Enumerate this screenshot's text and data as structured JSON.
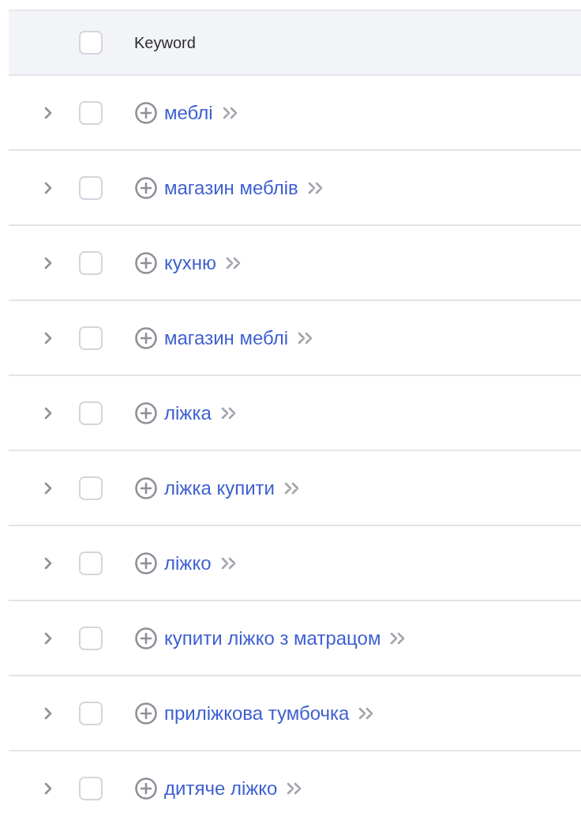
{
  "table": {
    "header": {
      "checked": false,
      "column": "Keyword"
    },
    "rows": [
      {
        "keyword": "меблі",
        "checked": false,
        "expanded": false
      },
      {
        "keyword": "магазин меблів",
        "checked": false,
        "expanded": false
      },
      {
        "keyword": "кухню",
        "checked": false,
        "expanded": false
      },
      {
        "keyword": "магазин меблі",
        "checked": false,
        "expanded": false
      },
      {
        "keyword": "ліжка",
        "checked": false,
        "expanded": false
      },
      {
        "keyword": "ліжка купити",
        "checked": false,
        "expanded": false
      },
      {
        "keyword": "ліжко",
        "checked": false,
        "expanded": false
      },
      {
        "keyword": "купити ліжко з матрацом",
        "checked": false,
        "expanded": false
      },
      {
        "keyword": "приліжкова тумбочка",
        "checked": false,
        "expanded": false
      },
      {
        "keyword": "дитяче ліжко",
        "checked": false,
        "expanded": false
      }
    ]
  }
}
